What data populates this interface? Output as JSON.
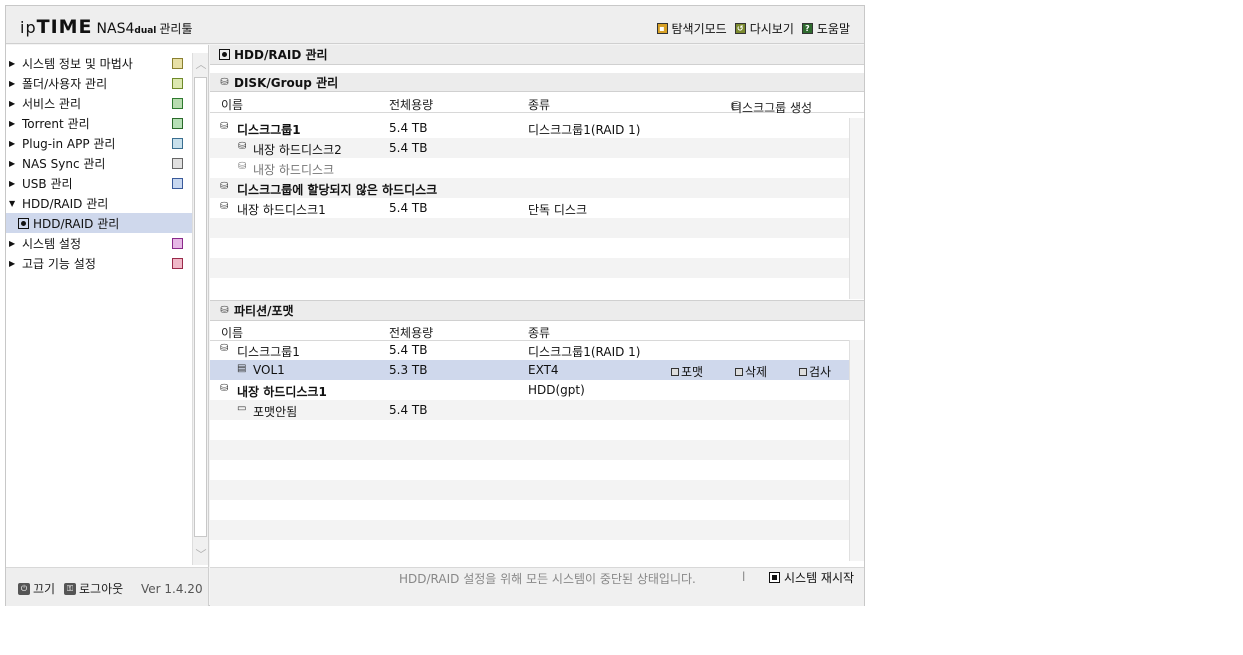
{
  "header": {
    "logo_ip": "ip",
    "logo_time": "TIME",
    "logo_nas": "NAS4",
    "logo_dual": "dual",
    "logo_tool": "관리툴",
    "links": {
      "explore_mode": "탐색기모드",
      "refresh": "다시보기",
      "help": "도움말"
    }
  },
  "sidebar": {
    "items": [
      {
        "label": "시스템 정보 및 마법사",
        "arrow": "▶"
      },
      {
        "label": "폴더/사용자 관리",
        "arrow": "▶"
      },
      {
        "label": "서비스 관리",
        "arrow": "▶"
      },
      {
        "label": "Torrent 관리",
        "arrow": "▶"
      },
      {
        "label": "Plug-in APP 관리",
        "arrow": "▶"
      },
      {
        "label": "NAS Sync 관리",
        "arrow": "▶"
      },
      {
        "label": "USB 관리",
        "arrow": "▶"
      },
      {
        "label": "HDD/RAID 관리",
        "arrow": "▼"
      },
      {
        "label": "시스템 설정",
        "arrow": "▶"
      },
      {
        "label": "고급 기능 설정",
        "arrow": "▶"
      }
    ],
    "sub_item": "HDD/RAID 관리",
    "footer": {
      "power": "끄기",
      "logout": "로그아웃",
      "version": "Ver 1.4.20"
    }
  },
  "main": {
    "page_title": "HDD/RAID 관리",
    "disk_section": {
      "title": "DISK/Group 관리",
      "columns": {
        "name": "이름",
        "capacity": "전체용량",
        "type": "종류"
      },
      "create_group": "디스크그룹 생성",
      "rows": [
        {
          "name": "디스크그룹1",
          "capacity": "5.4 TB",
          "type": "디스크그룹1(RAID 1)"
        },
        {
          "name": "내장 하드디스크2",
          "capacity": "5.4 TB",
          "type": ""
        },
        {
          "name": "내장 하드디스크",
          "capacity": "",
          "type": ""
        },
        {
          "name": "디스크그룹에 할당되지 않은 하드디스크",
          "capacity": "",
          "type": ""
        },
        {
          "name": "내장 하드디스크1",
          "capacity": "5.4 TB",
          "type": "단독 디스크"
        }
      ]
    },
    "partition_section": {
      "title": "파티션/포맷",
      "columns": {
        "name": "이름",
        "capacity": "전체용량",
        "type": "종류"
      },
      "rows": [
        {
          "name": "디스크그룹1",
          "capacity": "5.4 TB",
          "type": "디스크그룹1(RAID 1)"
        },
        {
          "name": "VOL1",
          "capacity": "5.3 TB",
          "type": "EXT4"
        },
        {
          "name": "내장 하드디스크1",
          "capacity": "",
          "type": "HDD(gpt)"
        },
        {
          "name": "포맷안됨",
          "capacity": "5.4 TB",
          "type": ""
        }
      ],
      "actions": {
        "format": "포맷",
        "delete": "삭제",
        "check": "검사"
      }
    }
  },
  "status": {
    "message": "HDD/RAID 설정을 위해 모든 시스템이 중단된 상태입니다.",
    "separator": "l",
    "restart": "시스템 재시작"
  }
}
